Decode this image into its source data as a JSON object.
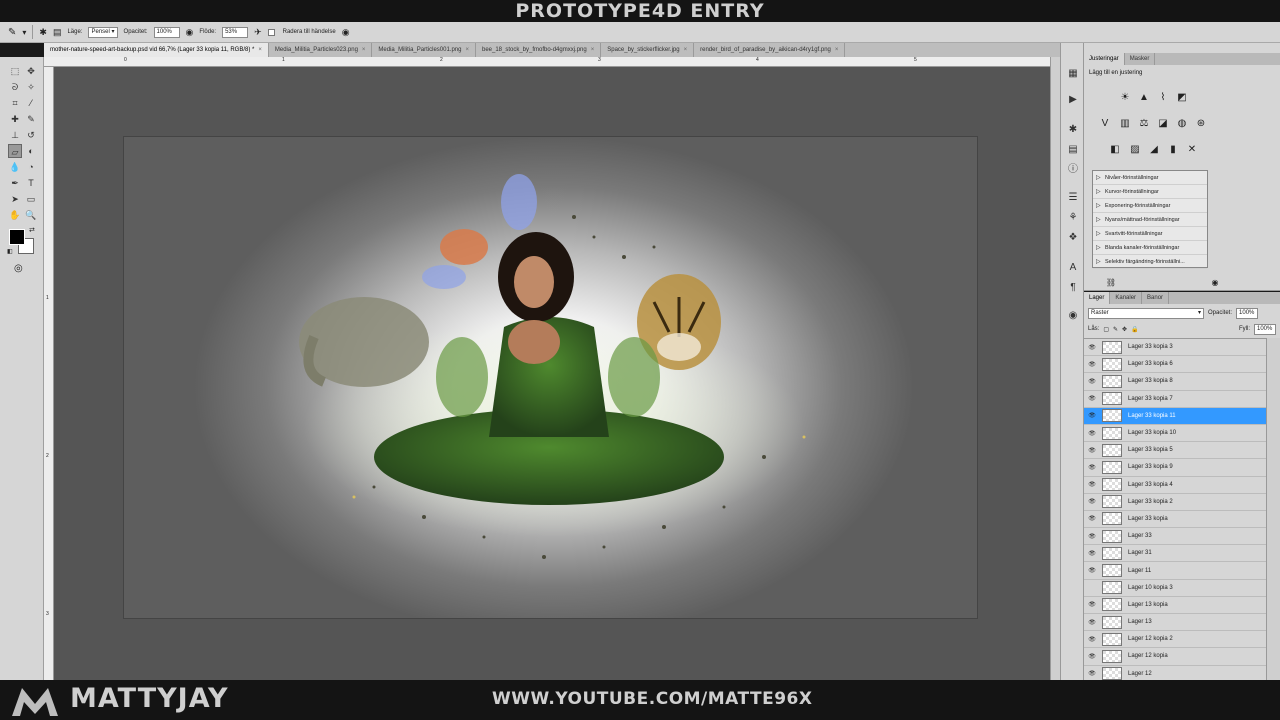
{
  "overlay": {
    "top_banner": "PROTOTYPE4D ENTRY",
    "brand": "MATTYJAY",
    "url": "WWW.YOUTUBE.COM/MATTE96X"
  },
  "options_bar": {
    "mode_label": "Läge:",
    "mode_value": "Pensel",
    "opacity_label": "Opacitet:",
    "opacity_value": "100%",
    "flow_label": "Flöde:",
    "flow_value": "53%",
    "erase_history_label": "Radera till händelse"
  },
  "doc_tabs": [
    "mother-nature-speed-art-backup.psd vid 66,7% (Lager 33 kopia 11, RGB/8) *",
    "Media_Militia_Particles023.png",
    "Media_Militia_Particles001.png",
    "bee_18_stock_by_fmofbo-d4gmxxj.png",
    "Space_by_stickerflicker.jpg",
    "render_bird_of_paradise_by_aikican-d4ry1gf.png"
  ],
  "rulers": {
    "top": [
      "0",
      "1",
      "2",
      "3",
      "4",
      "5"
    ],
    "left": [
      "1",
      "2",
      "3"
    ]
  },
  "adjustments_panel": {
    "tabs": [
      "Justeringar",
      "Masker"
    ],
    "title": "Lägg till en justering",
    "presets": [
      "Nivåer-förinställningar",
      "Kurvor-förinställningar",
      "Exponering-förinställningar",
      "Nyans/mättnad-förinställningar",
      "Svartvitt-förinställningar",
      "Blanda kanaler-förinställningar",
      "Selektiv färgändring-förinställni..."
    ]
  },
  "layers_panel": {
    "tabs": [
      "Lager",
      "Kanaler",
      "Banor"
    ],
    "blend_mode": "Raster",
    "opacity_label": "Opacitet:",
    "opacity_value": "100%",
    "lock_label": "Lås:",
    "fill_label": "Fyll:",
    "fill_value": "100%",
    "layers": [
      {
        "name": "Lager 33 kopia 3",
        "visible": true,
        "selected": false
      },
      {
        "name": "Lager 33 kopia 6",
        "visible": true,
        "selected": false
      },
      {
        "name": "Lager 33 kopia 8",
        "visible": true,
        "selected": false
      },
      {
        "name": "Lager 33 kopia 7",
        "visible": true,
        "selected": false
      },
      {
        "name": "Lager 33 kopia 11",
        "visible": true,
        "selected": true
      },
      {
        "name": "Lager 33 kopia 10",
        "visible": true,
        "selected": false
      },
      {
        "name": "Lager 33 kopia 5",
        "visible": true,
        "selected": false
      },
      {
        "name": "Lager 33 kopia 9",
        "visible": true,
        "selected": false
      },
      {
        "name": "Lager 33 kopia 4",
        "visible": true,
        "selected": false
      },
      {
        "name": "Lager 33 kopia 2",
        "visible": true,
        "selected": false
      },
      {
        "name": "Lager 33 kopia",
        "visible": true,
        "selected": false
      },
      {
        "name": "Lager 33",
        "visible": true,
        "selected": false
      },
      {
        "name": "Lager 31",
        "visible": true,
        "selected": false
      },
      {
        "name": "Lager 11",
        "visible": true,
        "selected": false
      },
      {
        "name": "Lager 10 kopia 3",
        "visible": false,
        "selected": false
      },
      {
        "name": "Lager 13 kopia",
        "visible": true,
        "selected": false
      },
      {
        "name": "Lager 13",
        "visible": true,
        "selected": false
      },
      {
        "name": "Lager 12 kopia 2",
        "visible": true,
        "selected": false
      },
      {
        "name": "Lager 12 kopia",
        "visible": true,
        "selected": false
      },
      {
        "name": "Lager 12",
        "visible": true,
        "selected": false
      }
    ]
  },
  "colors": {
    "selection": "#3399ff",
    "panel": "#d6d6d6",
    "pasteboard": "#555555"
  }
}
